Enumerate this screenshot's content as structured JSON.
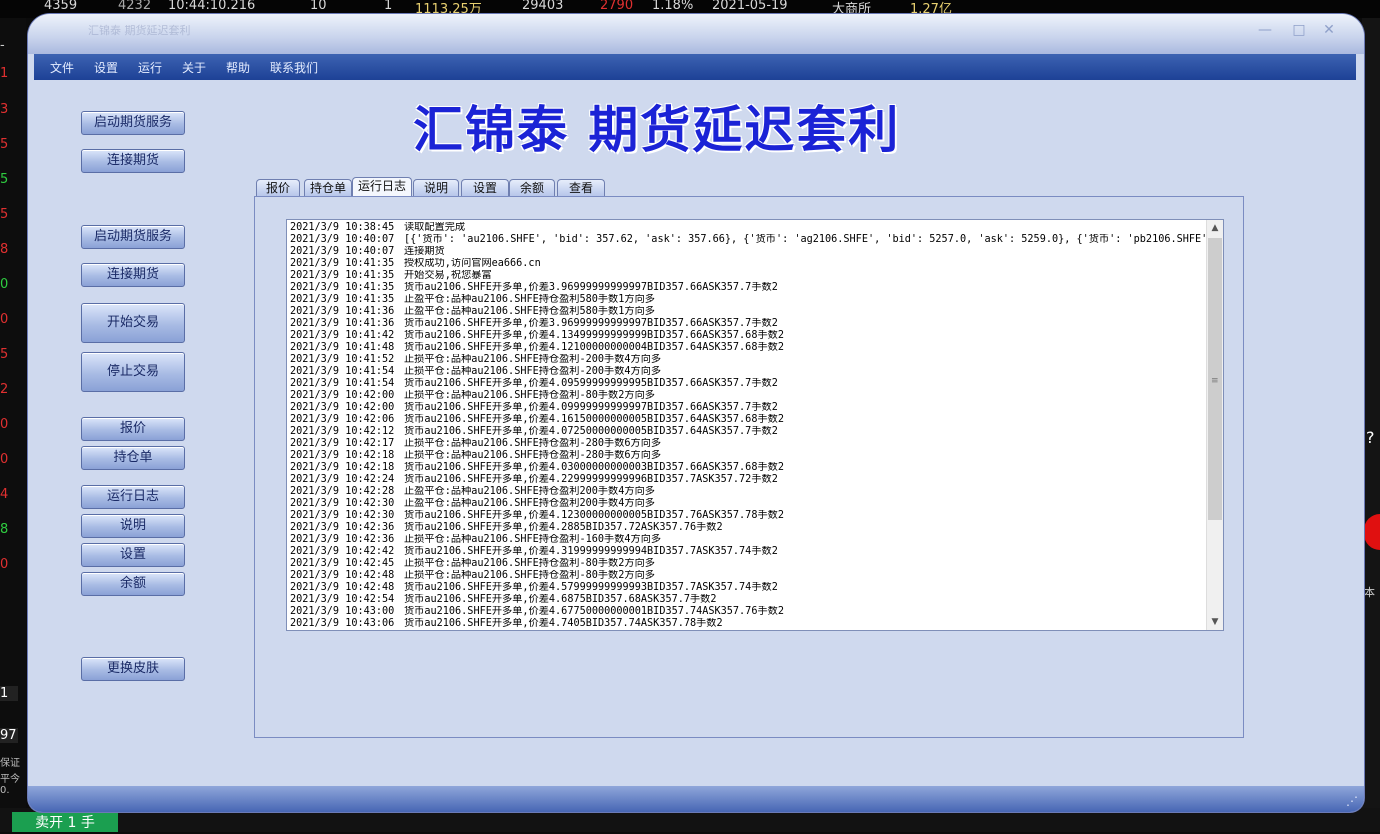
{
  "background": {
    "ticker": [
      "4359",
      "4232",
      "10:44:10.216",
      "10",
      "1",
      "1113.25万",
      "29403",
      "2790",
      "1.18%",
      "2021-05-19",
      "大商所",
      "1.27亿"
    ],
    "left_digits": [
      "-",
      "1",
      "3",
      "5",
      "5",
      "5",
      "8",
      "0",
      "0",
      "5",
      "2",
      "0",
      "0",
      "4",
      "8",
      "0"
    ],
    "qty_value": "1",
    "price_value": "97",
    "side_labels": [
      "保证",
      "平今0."
    ],
    "sell_button": "卖开 1 手",
    "right_labels": [
      "?",
      "本"
    ]
  },
  "window": {
    "title": "汇锦泰 期货延迟套利",
    "controls": {
      "minimize": "—",
      "maximize": "□",
      "close": "✕"
    },
    "menu": [
      "文件",
      "设置",
      "运行",
      "关于",
      "帮助",
      "联系我们"
    ],
    "headline": "汇锦泰  期货延迟套利"
  },
  "sidebar": {
    "start_service_1": "启动期货服务",
    "connect_1": "连接期货",
    "start_service_2": "启动期货服务",
    "connect_2": "连接期货",
    "start_trade": "开始交易",
    "stop_trade": "停止交易",
    "quote": "报价",
    "positions": "持仓单",
    "run_log": "运行日志",
    "about": "说明",
    "settings": "设置",
    "balance": "余额",
    "skin": "更换皮肤"
  },
  "tabs": [
    "报价",
    "持仓单",
    "运行日志",
    "说明",
    "设置",
    "余额",
    "查看"
  ],
  "active_tab": "运行日志",
  "log": [
    {
      "ts": "2021/3/9 10:38:45",
      "msg": "读取配置完成"
    },
    {
      "ts": "2021/3/9 10:40:07",
      "msg": "[{'货币': 'au2106.SHFE', 'bid': 357.62, 'ask': 357.66}, {'货币': 'ag2106.SHFE', 'bid': 5257.0, 'ask': 5259.0}, {'货币': 'pb2106.SHFE',"
    },
    {
      "ts": "2021/3/9 10:40:07",
      "msg": "连接期货"
    },
    {
      "ts": "2021/3/9 10:41:35",
      "msg": "授权成功,访问官网ea666.cn"
    },
    {
      "ts": "2021/3/9 10:41:35",
      "msg": "开始交易,祝您暴富"
    },
    {
      "ts": "2021/3/9 10:41:35",
      "msg": "货币au2106.SHFE开多单,价差3.96999999999997BID357.66ASK357.7手数2"
    },
    {
      "ts": "2021/3/9 10:41:35",
      "msg": "止盈平仓:品种au2106.SHFE持仓盈利580手数1方向多"
    },
    {
      "ts": "2021/3/9 10:41:36",
      "msg": "止盈平仓:品种au2106.SHFE持仓盈利580手数1方向多"
    },
    {
      "ts": "2021/3/9 10:41:36",
      "msg": "货币au2106.SHFE开多单,价差3.96999999999997BID357.66ASK357.7手数2"
    },
    {
      "ts": "2021/3/9 10:41:42",
      "msg": "货币au2106.SHFE开多单,价差4.13499999999999BID357.66ASK357.68手数2"
    },
    {
      "ts": "2021/3/9 10:41:48",
      "msg": "货币au2106.SHFE开多单,价差4.12100000000004BID357.64ASK357.68手数2"
    },
    {
      "ts": "2021/3/9 10:41:52",
      "msg": "止损平仓:品种au2106.SHFE持仓盈利-200手数4方向多"
    },
    {
      "ts": "2021/3/9 10:41:54",
      "msg": "止损平仓:品种au2106.SHFE持仓盈利-200手数4方向多"
    },
    {
      "ts": "2021/3/9 10:41:54",
      "msg": "货币au2106.SHFE开多单,价差4.09599999999995BID357.66ASK357.7手数2"
    },
    {
      "ts": "2021/3/9 10:42:00",
      "msg": "止损平仓:品种au2106.SHFE持仓盈利-80手数2方向多"
    },
    {
      "ts": "2021/3/9 10:42:00",
      "msg": "货币au2106.SHFE开多单,价差4.09999999999997BID357.66ASK357.7手数2"
    },
    {
      "ts": "2021/3/9 10:42:06",
      "msg": "货币au2106.SHFE开多单,价差4.16150000000005BID357.64ASK357.68手数2"
    },
    {
      "ts": "2021/3/9 10:42:12",
      "msg": "货币au2106.SHFE开多单,价差4.07250000000005BID357.64ASK357.7手数2"
    },
    {
      "ts": "2021/3/9 10:42:17",
      "msg": "止损平仓:品种au2106.SHFE持仓盈利-280手数6方向多"
    },
    {
      "ts": "2021/3/9 10:42:18",
      "msg": "止损平仓:品种au2106.SHFE持仓盈利-280手数6方向多"
    },
    {
      "ts": "2021/3/9 10:42:18",
      "msg": "货币au2106.SHFE开多单,价差4.03000000000003BID357.66ASK357.68手数2"
    },
    {
      "ts": "2021/3/9 10:42:24",
      "msg": "货币au2106.SHFE开多单,价差4.22999999999996BID357.7ASK357.72手数2"
    },
    {
      "ts": "2021/3/9 10:42:28",
      "msg": "止盈平仓:品种au2106.SHFE持仓盈利200手数4方向多"
    },
    {
      "ts": "2021/3/9 10:42:30",
      "msg": "止盈平仓:品种au2106.SHFE持仓盈利200手数4方向多"
    },
    {
      "ts": "2021/3/9 10:42:30",
      "msg": "货币au2106.SHFE开多单,价差4.12300000000005BID357.76ASK357.78手数2"
    },
    {
      "ts": "2021/3/9 10:42:36",
      "msg": "货币au2106.SHFE开多单,价差4.2885BID357.72ASK357.76手数2"
    },
    {
      "ts": "2021/3/9 10:42:36",
      "msg": "止损平仓:品种au2106.SHFE持仓盈利-160手数4方向多"
    },
    {
      "ts": "2021/3/9 10:42:42",
      "msg": "货币au2106.SHFE开多单,价差4.31999999999994BID357.7ASK357.74手数2"
    },
    {
      "ts": "2021/3/9 10:42:45",
      "msg": "止损平仓:品种au2106.SHFE持仓盈利-80手数2方向多"
    },
    {
      "ts": "2021/3/9 10:42:48",
      "msg": "止损平仓:品种au2106.SHFE持仓盈利-80手数2方向多"
    },
    {
      "ts": "2021/3/9 10:42:48",
      "msg": "货币au2106.SHFE开多单,价差4.57999999999993BID357.7ASK357.74手数2"
    },
    {
      "ts": "2021/3/9 10:42:54",
      "msg": "货币au2106.SHFE开多单,价差4.6875BID357.68ASK357.7手数2"
    },
    {
      "ts": "2021/3/9 10:43:00",
      "msg": "货币au2106.SHFE开多单,价差4.67750000000001BID357.74ASK357.76手数2"
    },
    {
      "ts": "2021/3/9 10:43:06",
      "msg": "货币au2106.SHFE开多单,价差4.7405BID357.74ASK357.78手数2"
    }
  ],
  "colors": {
    "headline": "#1b23d6",
    "menubar": "#1d4196",
    "window": "#cfd9ee"
  },
  "icons": {
    "scroll_up": "chevron-up-icon",
    "scroll_down": "chevron-down-icon",
    "resize": "resize-grip-icon"
  }
}
